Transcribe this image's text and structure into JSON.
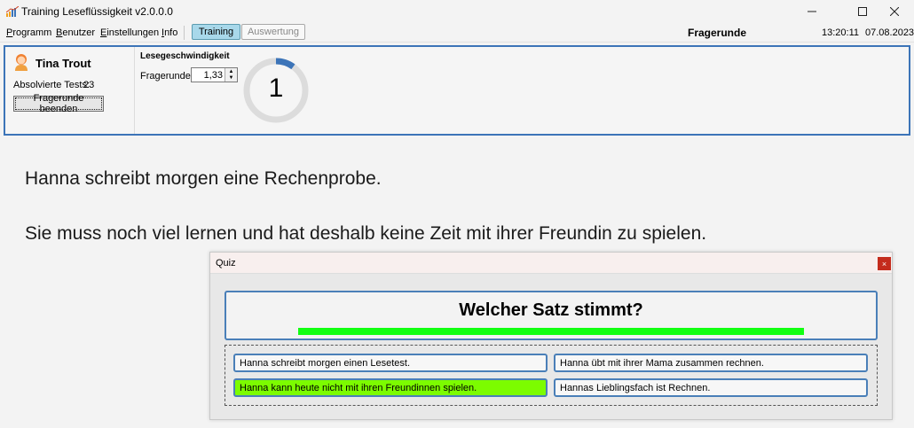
{
  "window": {
    "title": "Training Leseflüssigkeit v2.0.0.0"
  },
  "menu": {
    "items": [
      {
        "pre": "",
        "u": "P",
        "post": "rogramm"
      },
      {
        "pre": "",
        "u": "B",
        "post": "enutzer"
      },
      {
        "pre": "",
        "u": "E",
        "post": "instellungen"
      },
      {
        "pre": "",
        "u": "I",
        "post": "nfo"
      }
    ],
    "tab_training": "Training",
    "tab_evaluation": "Auswertung",
    "round_label": "Fragerunde",
    "time": "13:20:11",
    "date": "07.08.2023"
  },
  "user": {
    "name": "Tina Trout",
    "tests_label": "Absolvierte Tests:",
    "tests_value": "23",
    "end_button": "Fragerunde beenden"
  },
  "speed": {
    "title": "Lesegeschwindigkeit",
    "label": "Fragerunde:",
    "value": "1,33",
    "counter": "1",
    "progress": 0.1
  },
  "reading": {
    "sentences": [
      "Hanna schreibt morgen eine Rechenprobe.",
      "Sie muss noch viel lernen und hat deshalb keine Zeit mit ihrer Freundin zu spielen."
    ]
  },
  "quiz": {
    "title": "Quiz",
    "close": "×",
    "question": "Welcher Satz stimmt?",
    "time_left": 1.0,
    "answers": [
      "Hanna schreibt morgen einen Lesetest.",
      "Hanna übt mit ihrer Mama zusammen rechnen.",
      "Hanna kann heute nicht mit ihren Freundinnen spielen.",
      "Hannas Lieblingsfach ist Rechnen."
    ]
  },
  "colors": {
    "accent": "#3c74b8",
    "gauge_track": "#dcdcdc",
    "gauge_arc": "#3c74b8",
    "correct": "#7cfc00",
    "progress": "#12ff12"
  }
}
